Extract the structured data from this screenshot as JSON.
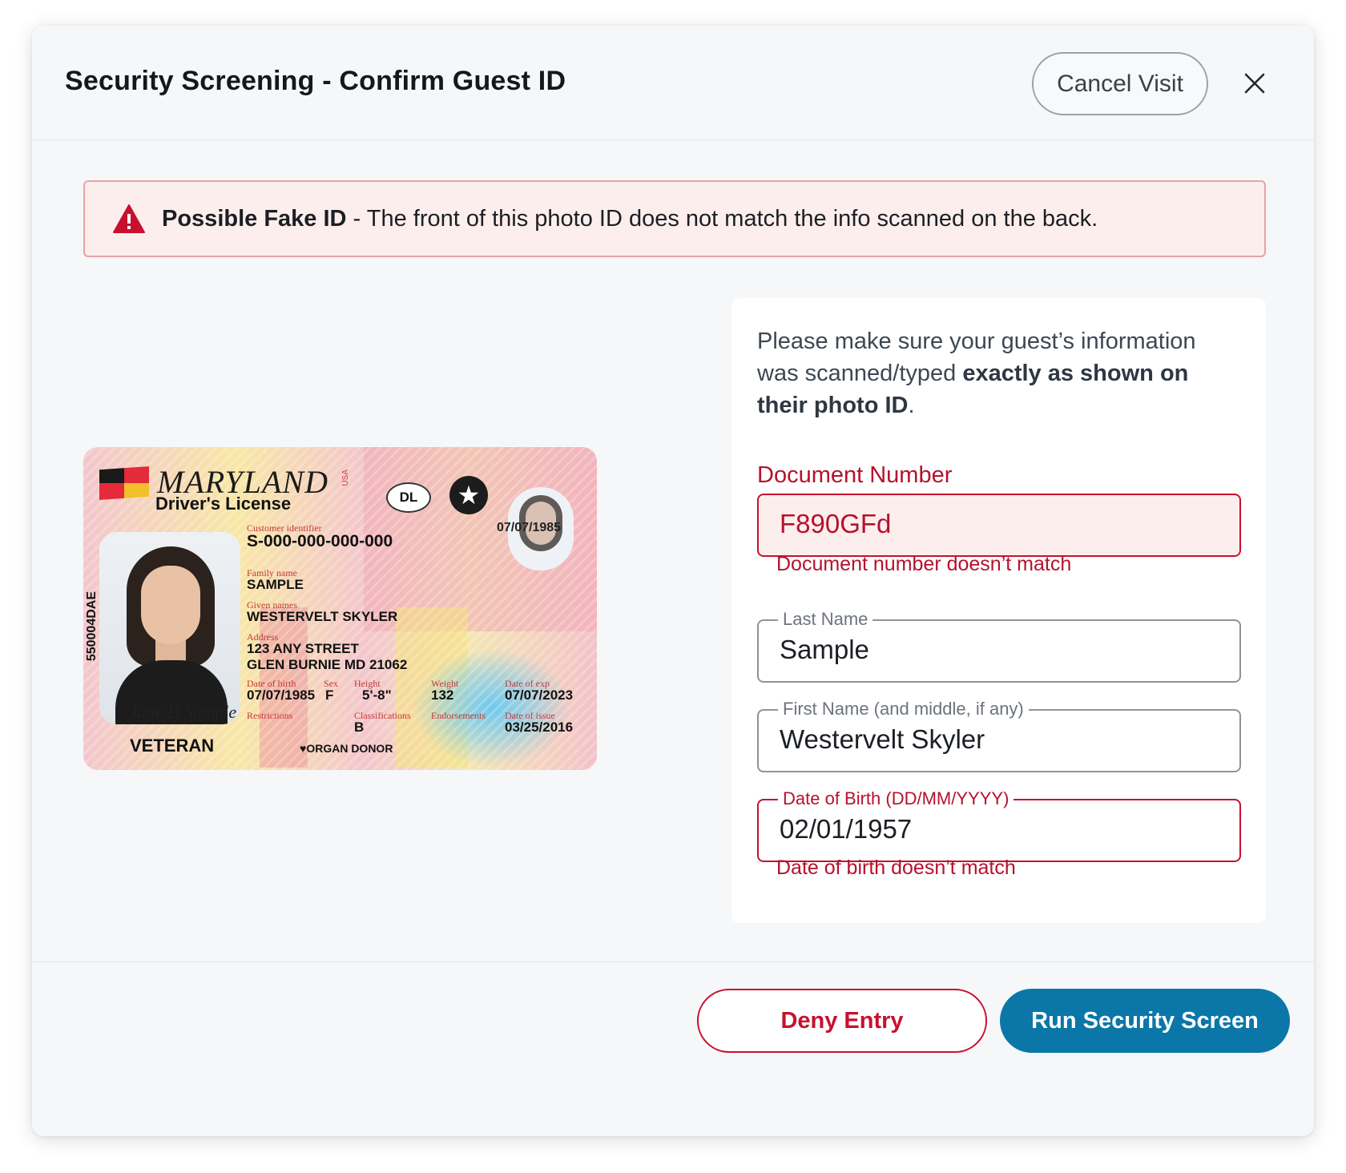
{
  "header": {
    "title": "Security Screening - Confirm Guest ID",
    "cancel_label": "Cancel Visit"
  },
  "alert": {
    "bold": "Possible Fake ID",
    "message": " - The front of this photo ID does not match the info scanned on the back."
  },
  "id_card": {
    "state": "MARYLAND",
    "state_suffix": "USA",
    "card_type": "Driver's License",
    "class_badge": "DL",
    "side_id": "550004DAE",
    "ghost_date": "07/07/1985",
    "customer_identifier_label": "Customer identifier",
    "customer_identifier": "S-000-000-000-000",
    "family_name_label": "Family name",
    "family_name": "SAMPLE",
    "given_names_label": "Given names",
    "given_names": "WESTERVELT SKYLER",
    "address_label": "Address",
    "address_line1": "123 ANY STREET",
    "address_line2": "GLEN BURNIE MD 21062",
    "dob_label": "Date of birth",
    "dob": "07/07/1985",
    "sex_label": "Sex",
    "sex": "F",
    "height_label": "Height",
    "height": "5'-8\"",
    "weight_label": "Weight",
    "weight": "132",
    "exp_label": "Date of exp",
    "exp": "07/07/2023",
    "restrictions_label": "Restrictions",
    "classifications_label": "Classifications",
    "classification": "B",
    "endorsements_label": "Endorsements",
    "issue_label": "Date of issue",
    "issue": "03/25/2016",
    "veteran": "VETERAN",
    "organ_donor": "♥ORGAN DONOR",
    "signature": "Jane D Sample"
  },
  "form": {
    "intro_plain": "Please make sure your guest’s information was scanned/typed ",
    "intro_bold": "exactly as shown on their photo ID",
    "intro_end": ".",
    "document_number_label": "Document Number",
    "document_number_value": "F890GFd",
    "document_number_error": "Document number doesn’t match",
    "last_name_label": "Last Name",
    "last_name_value": "Sample",
    "first_name_label": "First Name (and middle, if any)",
    "first_name_value": "Westervelt Skyler",
    "dob_label": "Date of Birth (DD/MM/YYYY)",
    "dob_value": "02/01/1957",
    "dob_error": "Date of birth doesn’t match"
  },
  "footer": {
    "deny_label": "Deny Entry",
    "run_label": "Run Security Screen"
  },
  "colors": {
    "error": "#c8102e",
    "primary": "#0a77a8",
    "alert_bg": "#fdeeee"
  }
}
